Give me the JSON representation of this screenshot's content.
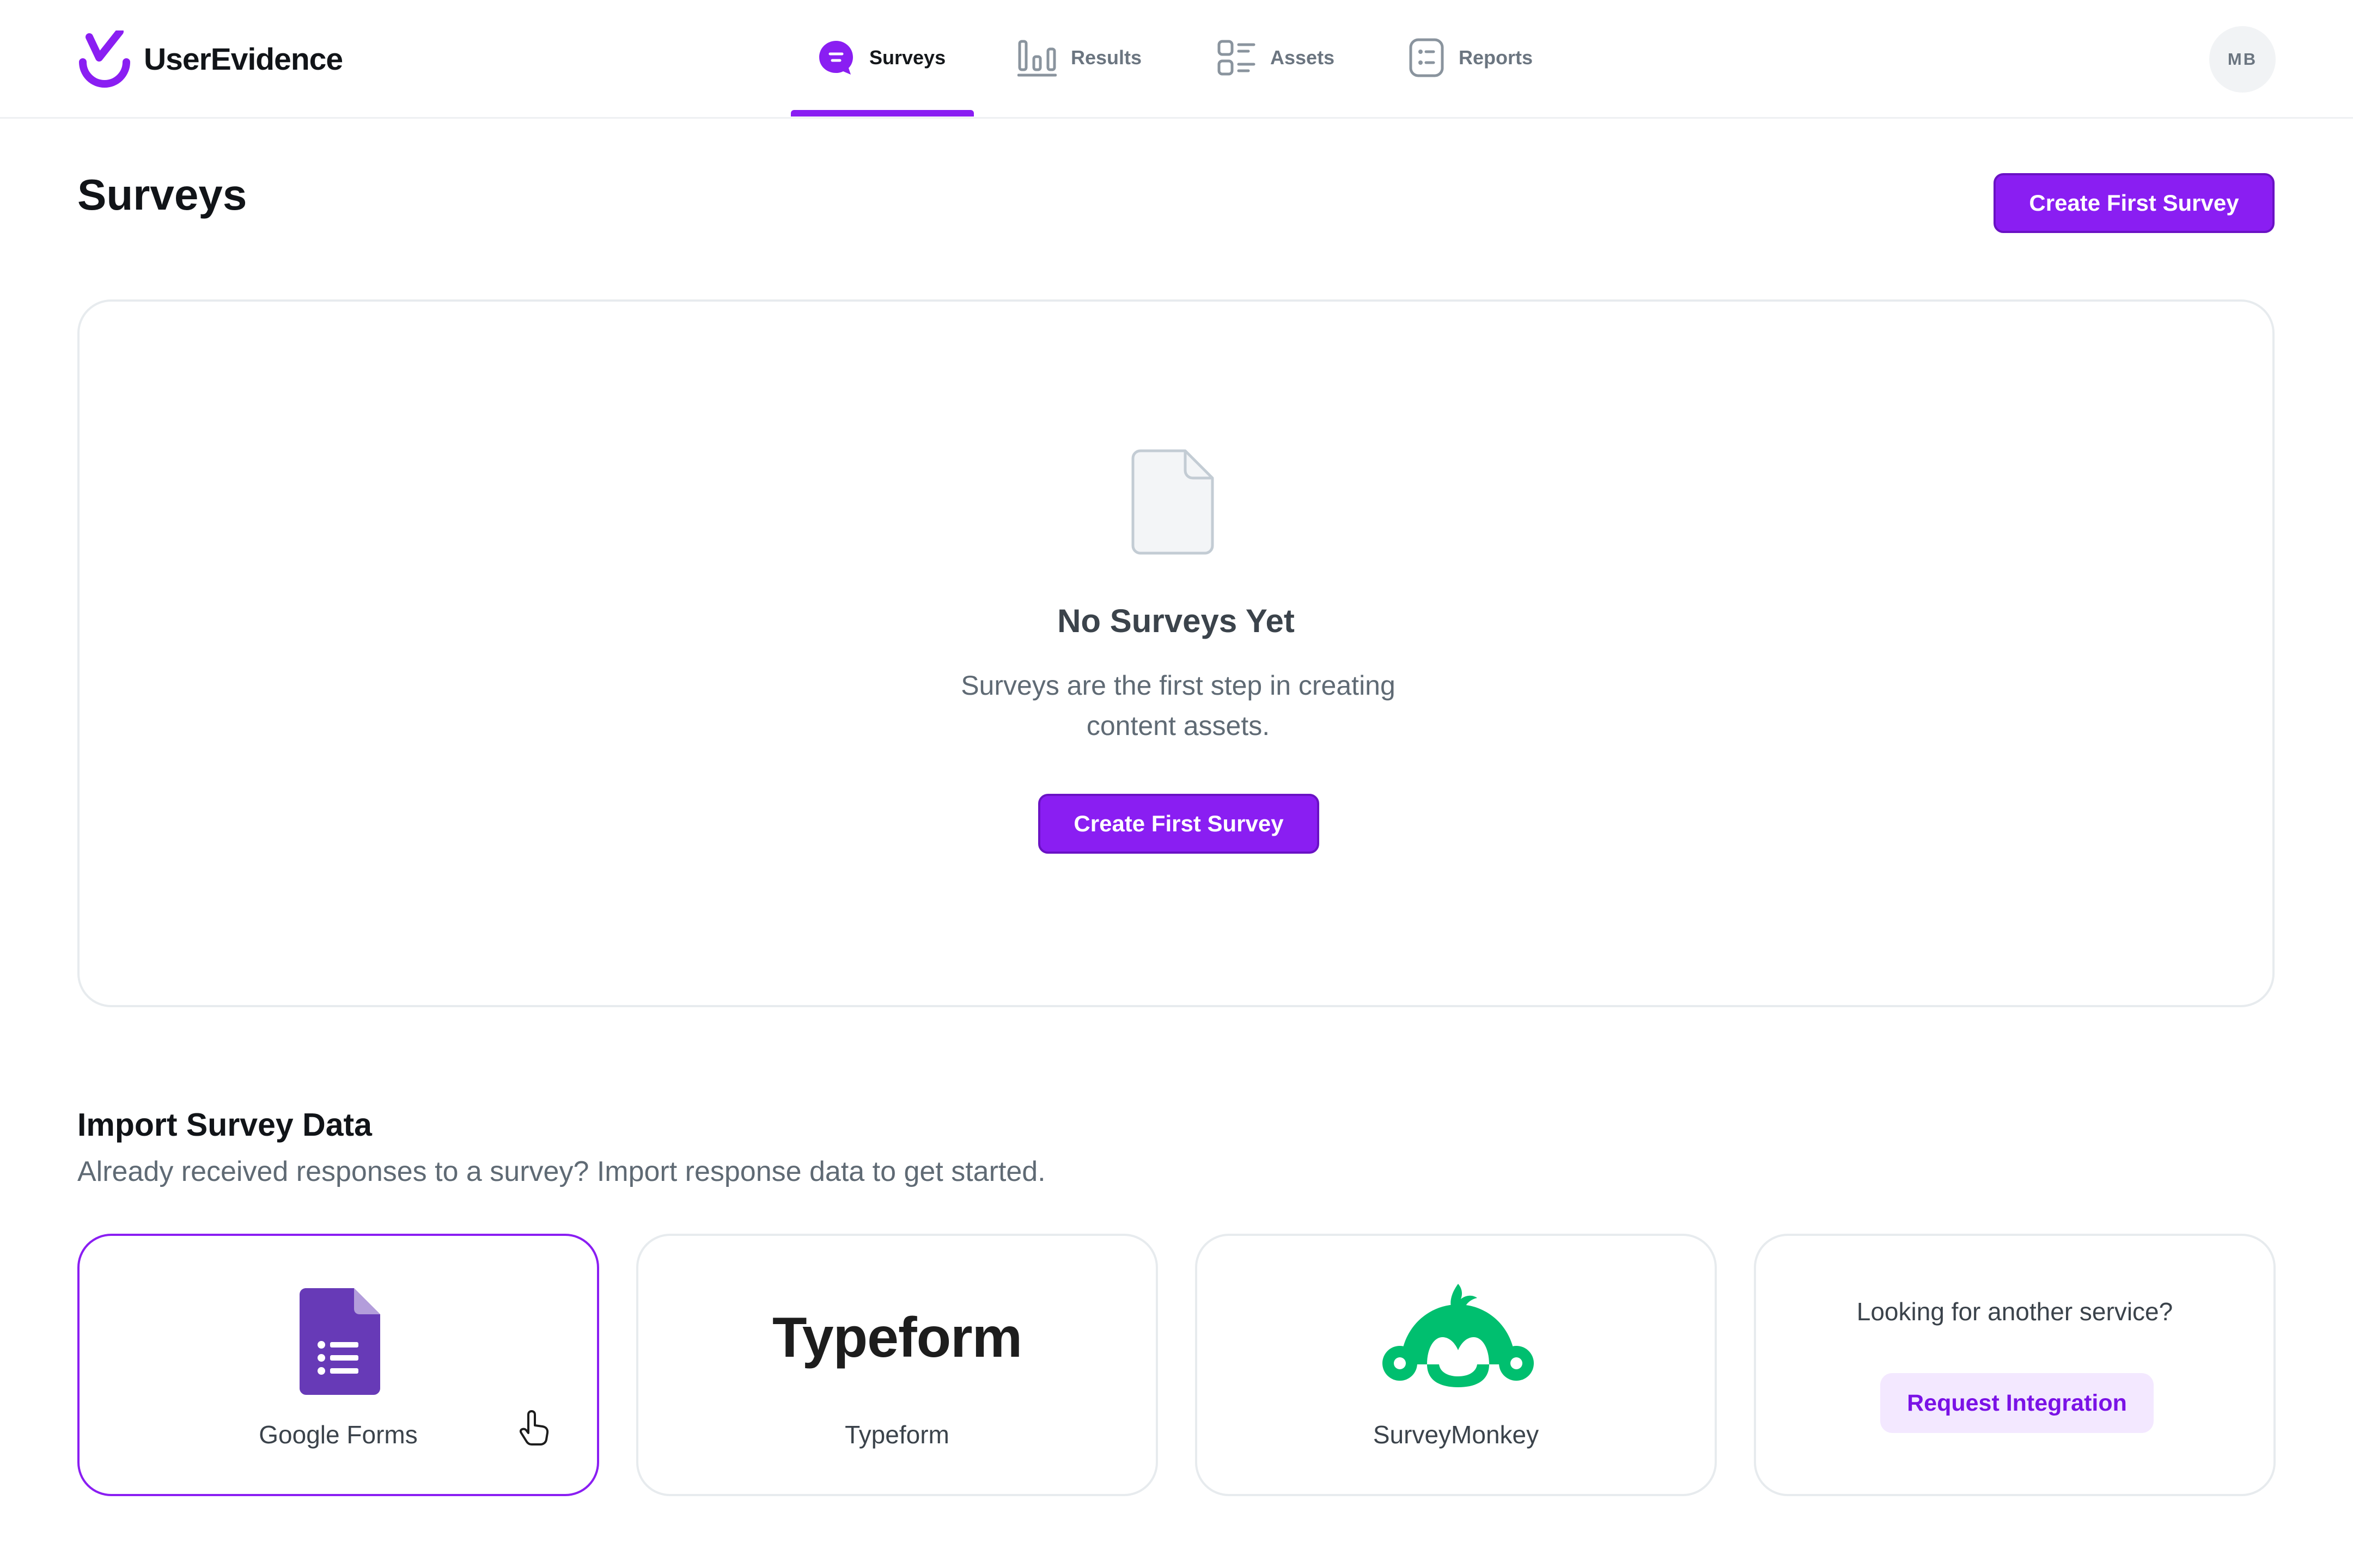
{
  "app": {
    "brand": "UserEvidence"
  },
  "nav": {
    "items": [
      {
        "label": "Surveys",
        "icon": "chat-bubble-icon",
        "active": true
      },
      {
        "label": "Results",
        "icon": "bar-chart-icon",
        "active": false
      },
      {
        "label": "Assets",
        "icon": "list-icon",
        "active": false
      },
      {
        "label": "Reports",
        "icon": "report-icon",
        "active": false
      }
    ],
    "avatar_initials": "MB"
  },
  "page": {
    "title": "Surveys",
    "create_button": "Create First Survey"
  },
  "empty_state": {
    "icon": "document-icon",
    "title": "No Surveys Yet",
    "description": "Surveys are the first step in creating content assets.",
    "button": "Create First Survey"
  },
  "import": {
    "title": "Import Survey Data",
    "subtitle": "Already received responses to a survey? Import response data to get started.",
    "cards": [
      {
        "label": "Google Forms",
        "icon": "google-forms-icon"
      },
      {
        "label": "Typeform",
        "logo_text": "Typeform"
      },
      {
        "label": "SurveyMonkey",
        "icon": "surveymonkey-icon"
      },
      {
        "prompt": "Looking for another service?",
        "button": "Request Integration"
      }
    ]
  },
  "colors": {
    "accent": "#8a1ef2",
    "google_forms": "#673ab7",
    "surveymonkey": "#00bf6f"
  }
}
